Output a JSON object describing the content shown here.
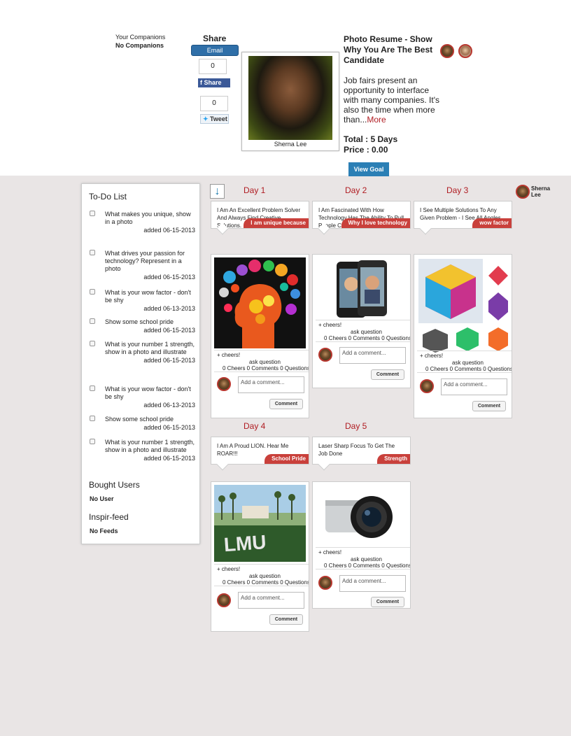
{
  "companions": {
    "title": "Your Companions",
    "none": "No Companions"
  },
  "share": {
    "title": "Share",
    "email_label": "Email",
    "fb_count": "0",
    "fb_label": "Share",
    "tweet_count": "0",
    "tweet_label": "Tweet"
  },
  "profile": {
    "name": "Sherna Lee"
  },
  "goal": {
    "title": "Photo Resume - Show Why You Are The Best Candidate",
    "description": "Job fairs present an opportunity to interface with many companies. It's also the time when more than...",
    "more_label": "More",
    "total": "Total : 5 Days",
    "price": "Price : 0.00",
    "view_label": "View Goal"
  },
  "sidebar": {
    "todo_title": "To-Do List",
    "todos": [
      {
        "text": "What makes you unique, show in a photo",
        "date": "added 06-15-2013"
      },
      {
        "text": "What drives your passion for technology? Represent in a photo",
        "date": "added 06-15-2013"
      },
      {
        "text": "What is your wow factor - don't be shy",
        "date": "added 06-13-2013"
      },
      {
        "text": "Show some school pride",
        "date": "added 06-15-2013"
      },
      {
        "text": "What is your number 1 strength, show in a photo and illustrate",
        "date": "added 06-15-2013"
      },
      {
        "text": "What is your wow factor - don't be shy",
        "date": "added 06-13-2013"
      },
      {
        "text": "Show some school pride",
        "date": "added 06-15-2013"
      },
      {
        "text": "What is your number 1 strength, show in a photo and illustrate",
        "date": "added 06-15-2013"
      }
    ],
    "bought_title": "Bought Users",
    "bought_none": "No User",
    "feed_title": "Inspir-feed",
    "feed_none": "No Feeds"
  },
  "right_user": {
    "name": "Sherna Lee"
  },
  "days": [
    {
      "title": "Day 1",
      "challenge": "I Am An Excellent Problem Solver And Always Find Creative Solutions.",
      "tag": "I am unique because",
      "image": "head-gears-icon"
    },
    {
      "title": "Day 2",
      "challenge": "I Am Fascinated With How Technology Has The Ability To Pull People Closer",
      "tag": "Why I love technology",
      "image": "phone-video-call-icon"
    },
    {
      "title": "Day 3",
      "challenge": "I See Multiple Solutions To Any Given Problem - I See All Angles",
      "tag": "wow factor",
      "image": "color-cubes-icon"
    },
    {
      "title": "Day 4",
      "challenge": "I Am A Proud LION. Hear Me ROAR!!!",
      "tag": "School Pride",
      "image": "lmu-sign-photo",
      "sign": "LMU"
    },
    {
      "title": "Day 5",
      "challenge": "Laser Sharp Focus To Get The Job Done",
      "tag": "Strength",
      "image": "camera-icon"
    }
  ],
  "post_ui": {
    "cheers": "+ cheers!",
    "ask": "ask question",
    "counts": "0 Cheers  0 Comments 0 Questions",
    "comment_placeholder": "Add a comment...",
    "comment_button": "Comment"
  }
}
